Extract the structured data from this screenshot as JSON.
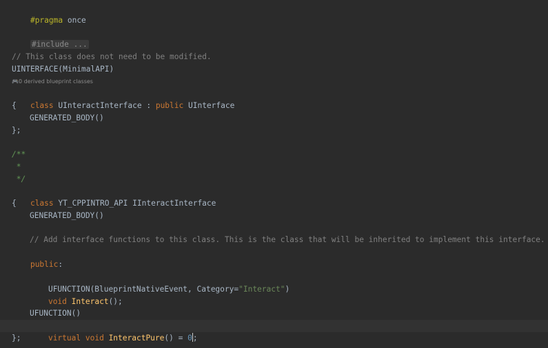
{
  "editor": {
    "line_pragma": {
      "directive": "#pragma",
      "rest": " once"
    },
    "line_include": {
      "folded": "#include ..."
    },
    "line_comment_class": "// This class does not need to be modified.",
    "line_uinterface": "UINTERFACE(MinimalAPI)",
    "hint": {
      "icon": "🎮",
      "text": "0 derived blueprint classes"
    },
    "line_class1": {
      "kw": "class",
      "name": " UInteractInterface : ",
      "kw2": "public",
      "rest": " UInterface"
    },
    "brace_open": "{",
    "generated_body": "GENERATED_BODY()",
    "brace_close": "};",
    "doc_open": "/**",
    "doc_star": " *",
    "doc_close": " */",
    "line_class2": {
      "kw": "class",
      "rest": " YT_CPPINTRO_API IInteractInterface"
    },
    "comment_add": "// Add interface functions to this class. This is the class that will be inherited to implement this interface.",
    "public_label": {
      "kw": "public",
      "colon": ":"
    },
    "ufunction1": {
      "prefix": "UFUNCTION(BlueprintNativeEvent, Category=",
      "string": "\"Interact\"",
      "suffix": ")"
    },
    "interact_decl": {
      "kw": "void",
      "name": "Interact",
      "rest": "();"
    },
    "ufunction2": "UFUNCTION()",
    "pure_decl": {
      "kw1": "virtual",
      "kw2": "void",
      "name": "InteractPure",
      "rest": "() = ",
      "num": "0",
      "semi": ";"
    }
  }
}
